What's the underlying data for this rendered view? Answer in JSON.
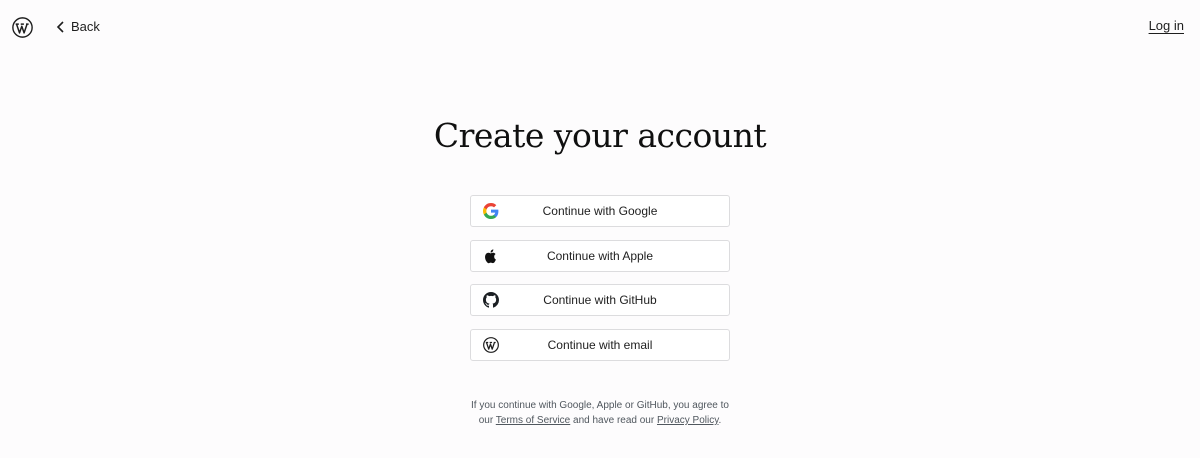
{
  "header": {
    "logo_icon": "wordpress-logo-icon",
    "back_icon": "chevron-left-icon",
    "back_label": "Back",
    "login_label": "Log in"
  },
  "main": {
    "title": "Create your account",
    "auth_buttons": [
      {
        "label": "Continue with Google",
        "icon": "google-icon"
      },
      {
        "label": "Continue with Apple",
        "icon": "apple-icon"
      },
      {
        "label": "Continue with GitHub",
        "icon": "github-icon"
      },
      {
        "label": "Continue with email",
        "icon": "wordpress-icon"
      }
    ]
  },
  "legal": {
    "line1": "If you continue with Google, Apple or GitHub, you agree to",
    "line2_prefix": "our ",
    "terms_link": "Terms of Service",
    "line2_middle": " and have read our ",
    "privacy_link": "Privacy Policy",
    "line2_suffix": "."
  },
  "colors": {
    "background": "#fdfcfd",
    "text": "#1e1e1e",
    "button_border": "#dcdcde",
    "legal_text": "#50575e"
  }
}
